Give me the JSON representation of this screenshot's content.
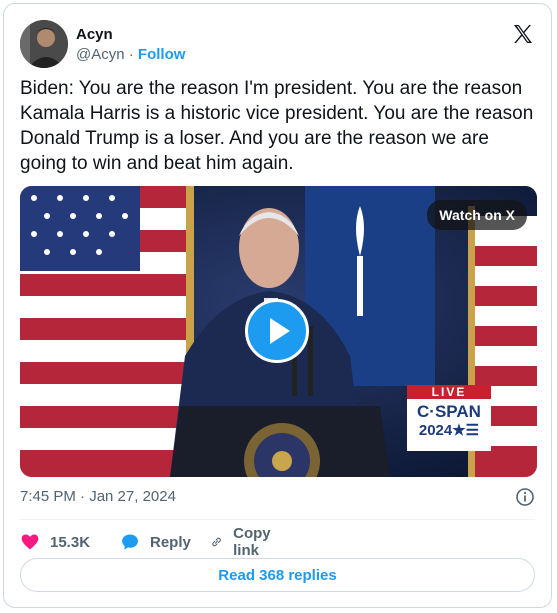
{
  "author": {
    "name": "Acyn",
    "handle": "@Acyn",
    "separator": "·",
    "follow_label": "Follow"
  },
  "tweet": {
    "text": "Biden: You are the reason I'm president. You are the reason Kamala Harris is a historic vice president. You are the reason Donald Trump is a loser. And you are the reason we are going to win and beat him again.",
    "timestamp": "7:45 PM · Jan 27, 2024"
  },
  "media": {
    "watch_label": "Watch on X",
    "live_badge": "LIVE",
    "network": "C·SPAN",
    "network_year": "2024★☰"
  },
  "actions": {
    "likes_count": "15.3K",
    "reply_label": "Reply",
    "copy_link_label": "Copy link",
    "read_replies_label": "Read 368 replies"
  },
  "colors": {
    "accent": "#1d9bf0",
    "like": "#f91880",
    "text": "#0f1419",
    "muted": "#536471"
  }
}
